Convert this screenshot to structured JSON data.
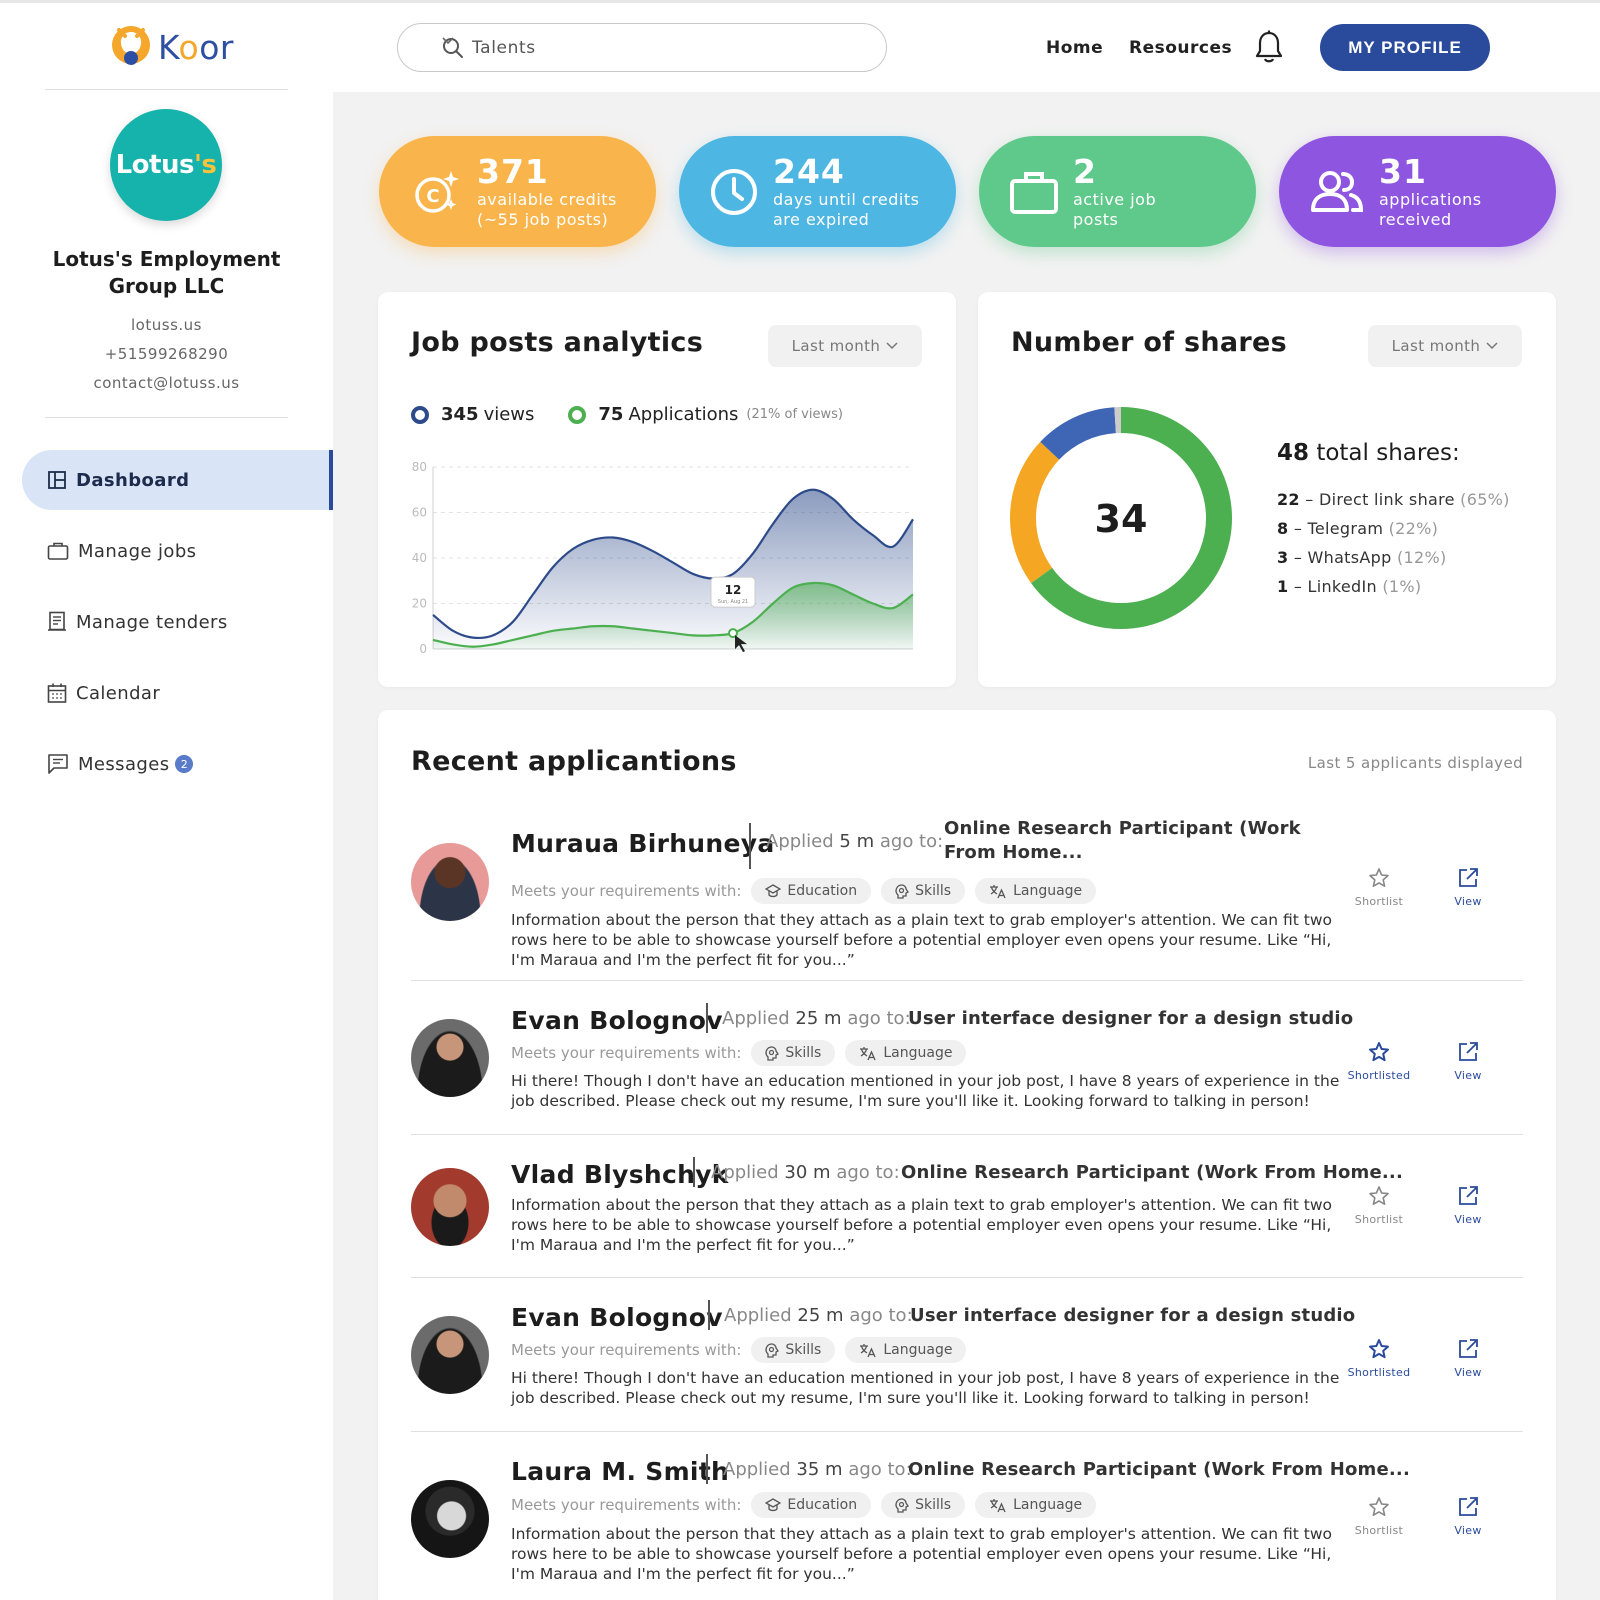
{
  "header": {
    "brand": "Koor",
    "search_label": "Talents",
    "nav": [
      "Home",
      "Resources"
    ],
    "profile_button": "MY PROFILE"
  },
  "sidebar": {
    "company_logo_text": "Lotus's",
    "company_name": "Lotus's Employment Group LLC",
    "website": "lotuss.us",
    "phone": "+51599268290",
    "email": "contact@lotuss.us",
    "menu": [
      {
        "label": "Dashboard",
        "icon": "dashboard-icon",
        "active": true
      },
      {
        "label": "Manage jobs",
        "icon": "briefcase-icon"
      },
      {
        "label": "Manage tenders",
        "icon": "document-icon"
      },
      {
        "label": "Calendar",
        "icon": "calendar-icon"
      },
      {
        "label": "Messages",
        "icon": "message-icon",
        "badge": "2"
      }
    ]
  },
  "stats": [
    {
      "value": "371",
      "line1": "available credits",
      "line2": "(~55 job posts)",
      "color": "#f9b54c",
      "icon": "credits-icon"
    },
    {
      "value": "244",
      "line1": "days until credits",
      "line2": "are expired",
      "color": "#4eb6e3",
      "icon": "clock-icon"
    },
    {
      "value": "2",
      "line1": "active job",
      "line2": "posts",
      "color": "#5ec98a",
      "icon": "briefcase-icon"
    },
    {
      "value": "31",
      "line1": "applications",
      "line2": "received",
      "color": "#8e55e0",
      "icon": "users-icon"
    }
  ],
  "analytics": {
    "title": "Job posts analytics",
    "period": "Last month",
    "views_value": "345",
    "views_label": "views",
    "applications_value": "75",
    "applications_label": "Applications",
    "applications_note": "(21% of views)",
    "tooltip_value": "12",
    "tooltip_sub": "Sun, Aug 21"
  },
  "chart_data": {
    "type": "area",
    "ylim": [
      0,
      80
    ],
    "y_ticks": [
      0,
      20,
      40,
      60,
      80
    ],
    "x": [
      0,
      1,
      2,
      3,
      4,
      5,
      6,
      7,
      8,
      9,
      10,
      11,
      12,
      13,
      14,
      15,
      16,
      17,
      18,
      19,
      20,
      21,
      22,
      23,
      24
    ],
    "series": [
      {
        "values": [
          15,
          8,
          5,
          6,
          12,
          24,
          36,
          44,
          48,
          49,
          47,
          43,
          38,
          33,
          31,
          33,
          42,
          55,
          66,
          70,
          66,
          57,
          50,
          45,
          57
        ],
        "color": "#2d4a8a"
      },
      {
        "values": [
          4,
          2,
          1,
          2,
          4,
          6,
          8,
          9,
          10,
          10,
          9,
          8,
          7,
          6,
          6,
          7,
          12,
          20,
          27,
          29,
          28,
          24,
          20,
          18,
          24
        ],
        "color": "#4caf50"
      }
    ]
  },
  "shares": {
    "title": "Number of shares",
    "period": "Last month",
    "center_value": "34",
    "total_value": "48",
    "total_label": "total shares:",
    "items": [
      {
        "count": "22",
        "label": "Direct link share",
        "pct": "(65%)",
        "value": 65,
        "color": "#4caf50"
      },
      {
        "count": "8",
        "label": "Telegram",
        "pct": "(22%)",
        "value": 22,
        "color": "#f5a623"
      },
      {
        "count": "3",
        "label": "WhatsApp",
        "pct": "(12%)",
        "value": 12,
        "color": "#3f66b5"
      },
      {
        "count": "1",
        "label": "LinkedIn",
        "pct": "(1%)",
        "value": 1,
        "color": "#cccccc"
      }
    ]
  },
  "recent": {
    "title": "Recent applicantions",
    "note": "Last 5 applicants displayed",
    "meets_label": "Meets your requirements with:",
    "applied_prefix": "Applied",
    "applied_suffix": "ago to:",
    "shortlist_label": "Shortlist",
    "shortlisted_label": "Shortlisted",
    "view_label": "View",
    "applicants": [
      {
        "name": "Muraua Birhuneya",
        "time": "5 m",
        "job": "Online Research Participant (Work From Home...",
        "tags": [
          "Education",
          "Skills",
          "Language"
        ],
        "desc": "Information about the person that they attach as a plain text to grab employer's attention. We can fit two rows here to be able to showcase yourself before a potential employer even opens your resume. Like “Hi, I'm Maraua and I'm the perfect fit for you...”",
        "shortlisted": false
      },
      {
        "name": "Evan Bolognov",
        "time": "25 m",
        "job": "User interface designer for a design studio",
        "tags": [
          "Skills",
          "Language"
        ],
        "desc": "Hi there! Though I don't have an education mentioned in your job post, I have 8 years of experience in the job described. Please check out my resume, I'm sure you'll like it. Looking forward to talking in person!",
        "shortlisted": true
      },
      {
        "name": "Vlad Blyshchyk",
        "time": "30 m",
        "job": "Online Research Participant (Work From Home...",
        "tags": [],
        "desc": "Information about the person that they attach as a plain text to grab employer's attention. We can fit two rows here to be able to showcase yourself before a potential employer even opens your resume. Like “Hi, I'm Maraua and I'm the perfect fit for you...”",
        "shortlisted": false
      },
      {
        "name": "Evan Bolognov",
        "time": "25 m",
        "job": "User interface designer for a design studio",
        "tags": [
          "Skills",
          "Language"
        ],
        "desc": "Hi there! Though I don't have an education mentioned in your job post, I have 8 years of experience in the job described. Please check out my resume, I'm sure you'll like it. Looking forward to talking in person!",
        "shortlisted": true
      },
      {
        "name": "Laura M. Smith",
        "time": "35 m",
        "job": "Online Research Participant (Work From Home...",
        "tags": [
          "Education",
          "Skills",
          "Language"
        ],
        "desc": "Information about the person that they attach as a plain text to grab employer's attention. We can fit two rows here to be able to showcase yourself before a potential employer even opens your resume. Like “Hi, I'm Maraua and I'm the perfect fit for you...”",
        "shortlisted": false
      }
    ]
  }
}
